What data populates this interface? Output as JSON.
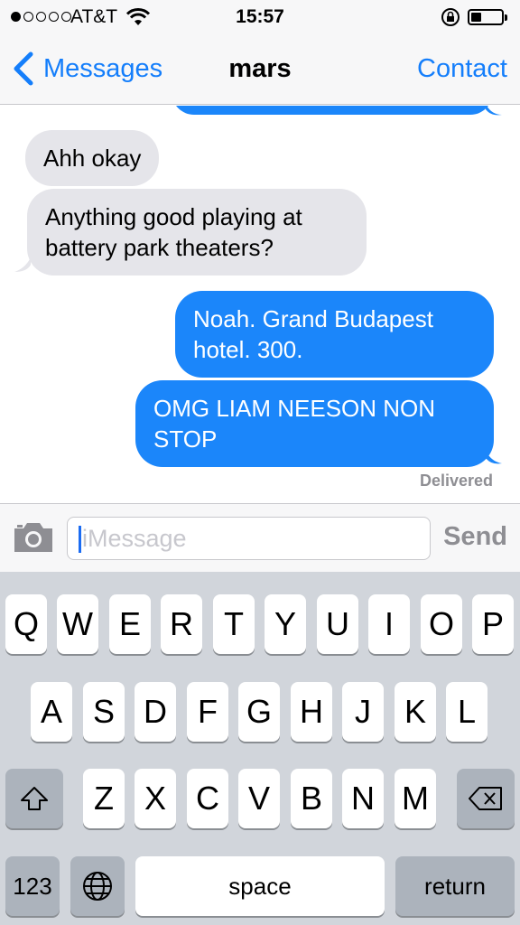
{
  "status_bar": {
    "carrier": "AT&T",
    "time": "15:57",
    "signal_bars_filled": 1,
    "signal_bars_total": 5,
    "battery_level": 0.35
  },
  "nav": {
    "back_label": "Messages",
    "title": "mars",
    "contact_label": "Contact"
  },
  "messages": [
    {
      "direction": "incoming",
      "text": "Ahh okay"
    },
    {
      "direction": "incoming",
      "text_lines": [
        "Anything good playing at",
        "battery park theaters?"
      ]
    },
    {
      "direction": "outgoing",
      "text_lines": [
        "Noah. Grand Budapest",
        "hotel. 300."
      ]
    },
    {
      "direction": "outgoing",
      "text_lines": [
        "OMG LIAM NEESON NON",
        "STOP"
      ]
    }
  ],
  "delivered_label": "Delivered",
  "composer": {
    "placeholder": "iMessage",
    "send_label": "Send"
  },
  "keyboard": {
    "row1": [
      "Q",
      "W",
      "E",
      "R",
      "T",
      "Y",
      "U",
      "I",
      "O",
      "P"
    ],
    "row2": [
      "A",
      "S",
      "D",
      "F",
      "G",
      "H",
      "J",
      "K",
      "L"
    ],
    "row3": [
      "Z",
      "X",
      "C",
      "V",
      "B",
      "N",
      "M"
    ],
    "numbers_label": "123",
    "space_label": "space",
    "return_label": "return"
  },
  "colors": {
    "accent": "#147efb",
    "outgoing_bubble": "#1b86fa",
    "incoming_bubble": "#e5e5ea"
  }
}
